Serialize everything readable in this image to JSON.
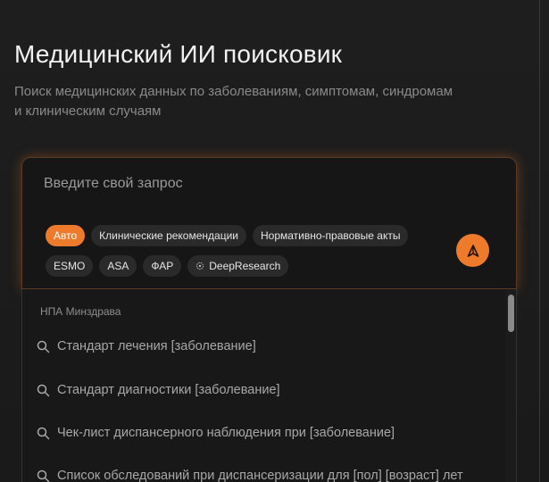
{
  "header": {
    "title": "Медицинский ИИ поисковик",
    "subtitle": "Поиск медицинских данных по заболеваниям, симптомам, синдромам и клиническим случаям"
  },
  "search": {
    "placeholder": "Введите свой запрос"
  },
  "chips": {
    "auto": "Авто",
    "clinical": "Клинические рекомендации",
    "legal": "Нормативно-правовые акты",
    "esmo": "ESMO",
    "asa": "ASA",
    "fap": "ФАР",
    "deepresearch": "DeepResearch"
  },
  "dropdown": {
    "section_title": "НПА Минздрава",
    "items": [
      "Стандарт лечения [заболевание]",
      "Стандарт диагностики [заболевание]",
      "Чек-лист диспансерного наблюдения при [заболевание]",
      "Список обследований при диспансеризации для [пол] [возраст] лет"
    ]
  },
  "colors": {
    "accent": "#ee7b2c",
    "background": "#1c1c1c",
    "chip": "#2a2a2a"
  }
}
